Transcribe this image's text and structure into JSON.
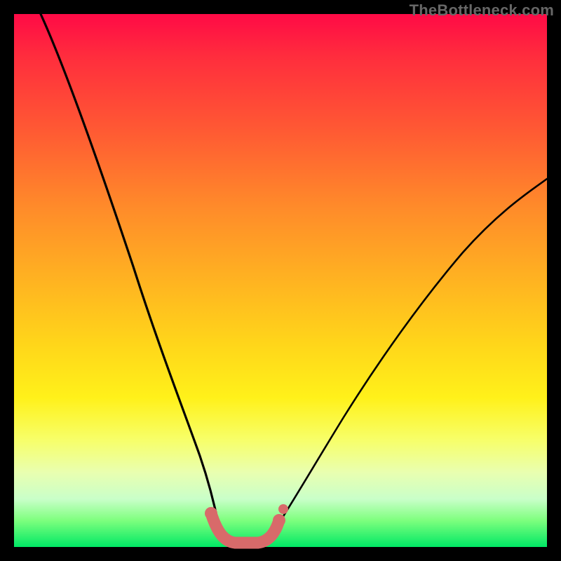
{
  "watermark": "TheBottleneck.com",
  "colors": {
    "page_bg": "#000000",
    "gradient_top": "#ff0a46",
    "gradient_bottom": "#00e865",
    "curve_stroke": "#000000",
    "bottom_arc_stroke": "#d86a6a"
  },
  "chart_data": {
    "type": "line",
    "title": "",
    "xlabel": "",
    "ylabel": "",
    "xlim": [
      0,
      100
    ],
    "ylim": [
      0,
      100
    ],
    "series": [
      {
        "name": "left-curve",
        "x": [
          5,
          8,
          12,
          16,
          20,
          24,
          28,
          31,
          33.5,
          35.5,
          37,
          38
        ],
        "y": [
          100,
          92,
          80,
          68,
          55,
          42,
          30,
          20,
          12,
          7,
          4,
          2
        ]
      },
      {
        "name": "right-curve",
        "x": [
          48,
          50,
          53,
          57,
          62,
          68,
          75,
          83,
          92,
          100
        ],
        "y": [
          3,
          5,
          9,
          15,
          22,
          30,
          40,
          50,
          60,
          69
        ]
      },
      {
        "name": "bottom-arc-thick",
        "x": [
          36,
          38,
          40,
          42,
          44,
          46,
          48,
          49.5
        ],
        "y": [
          6,
          2.5,
          1,
          0.5,
          0.5,
          1,
          2,
          4
        ]
      }
    ],
    "annotations": []
  }
}
